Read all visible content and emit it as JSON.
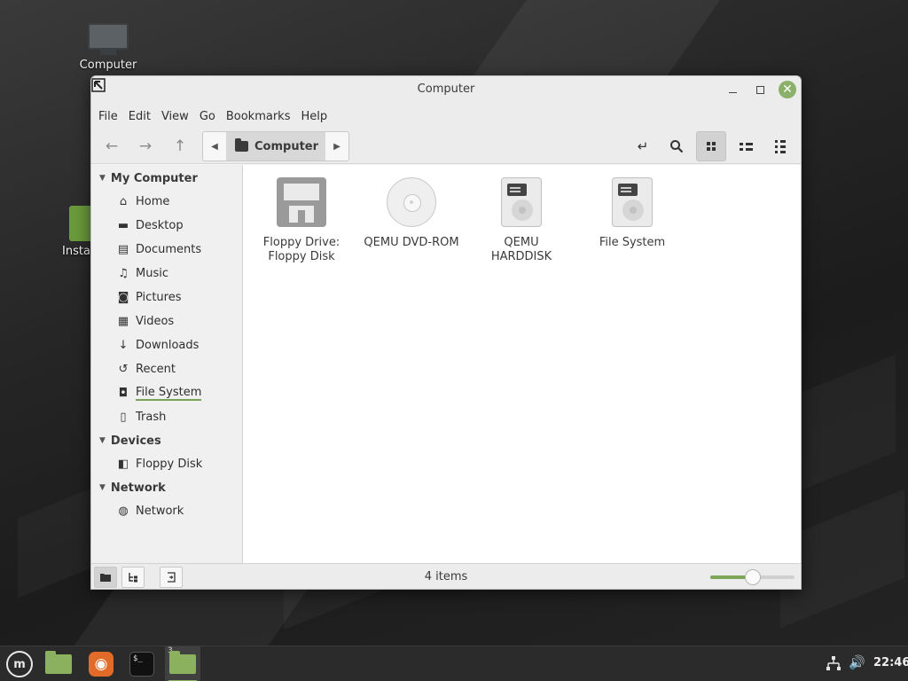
{
  "desktop": {
    "icons": [
      {
        "label": "Computer",
        "icon": "computer-icon"
      },
      {
        "label": "Install Linux Mint",
        "icon": "install-icon"
      }
    ]
  },
  "window": {
    "title": "Computer",
    "close_glyph": "✕"
  },
  "menubar": {
    "items": [
      "File",
      "Edit",
      "View",
      "Go",
      "Bookmarks",
      "Help"
    ]
  },
  "toolbar": {
    "back_glyph": "←",
    "forward_glyph": "→",
    "up_glyph": "↑",
    "path_left_glyph": "◀",
    "path_right_glyph": "▶",
    "location": "Computer",
    "toggle_location_glyph": "↵",
    "search_glyph": "⌕",
    "active_view": "icon"
  },
  "sidebar": {
    "sections": [
      {
        "title": "My Computer",
        "items": [
          {
            "label": "Home",
            "icon": "home-icon",
            "glyph": "⌂"
          },
          {
            "label": "Desktop",
            "icon": "desktop-icon",
            "glyph": "▬"
          },
          {
            "label": "Documents",
            "icon": "documents-icon",
            "glyph": "▤"
          },
          {
            "label": "Music",
            "icon": "music-icon",
            "glyph": "♫"
          },
          {
            "label": "Pictures",
            "icon": "pictures-icon",
            "glyph": "◙"
          },
          {
            "label": "Videos",
            "icon": "videos-icon",
            "glyph": "▦"
          },
          {
            "label": "Downloads",
            "icon": "downloads-icon",
            "glyph": "↓"
          },
          {
            "label": "Recent",
            "icon": "recent-icon",
            "glyph": "↺"
          },
          {
            "label": "File System",
            "icon": "filesystem-icon",
            "glyph": "◘"
          },
          {
            "label": "Trash",
            "icon": "trash-icon",
            "glyph": "▯"
          }
        ]
      },
      {
        "title": "Devices",
        "items": [
          {
            "label": "Floppy Disk",
            "icon": "floppy-icon",
            "glyph": "◧"
          }
        ]
      },
      {
        "title": "Network",
        "items": [
          {
            "label": "Network",
            "icon": "network-globe-icon",
            "glyph": "◍"
          }
        ]
      }
    ],
    "collapse_glyph": "▼",
    "filesystem_usage_accent": "#7aa158"
  },
  "files": [
    {
      "name": "Floppy Drive: Floppy Disk",
      "line1": "Floppy Drive:",
      "line2": "Floppy Disk",
      "type": "floppy"
    },
    {
      "name": "QEMU DVD-ROM",
      "line1": "QEMU DVD-ROM",
      "line2": "",
      "type": "dvd"
    },
    {
      "name": "QEMU HARDDISK",
      "line1": "QEMU HARDDISK",
      "line2": "",
      "type": "hdd"
    },
    {
      "name": "File System",
      "line1": "File System",
      "line2": "",
      "type": "hdd"
    }
  ],
  "statusbar": {
    "status": "4 items",
    "zoom_level": 0.5
  },
  "taskbar": {
    "workspace_count": "3",
    "terminal_text": "$_",
    "menu_glyph": "m",
    "firefox_glyph": "◉",
    "network_glyph": "⊥",
    "volume_glyph": "🔊",
    "clock": "22:46",
    "accent": "#8cb15e"
  }
}
